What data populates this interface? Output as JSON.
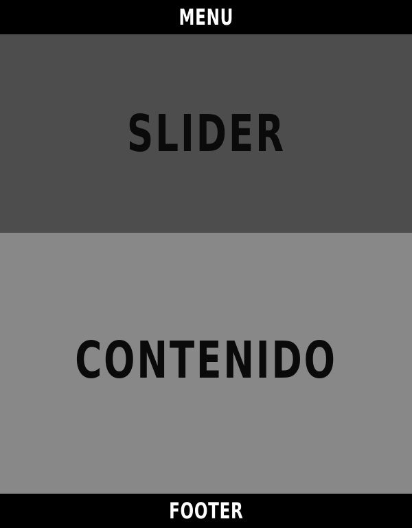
{
  "header": {
    "label": "MENU"
  },
  "slider": {
    "label": "SLIDER"
  },
  "content": {
    "label": "CONTENIDO"
  },
  "footer": {
    "label": "FOOTER"
  },
  "colors": {
    "menu_bg": "#000000",
    "slider_bg": "#4d4d4d",
    "content_bg": "#888888",
    "footer_bg": "#000000",
    "light_text": "#ffffff",
    "dark_text": "#0a0a0a"
  }
}
